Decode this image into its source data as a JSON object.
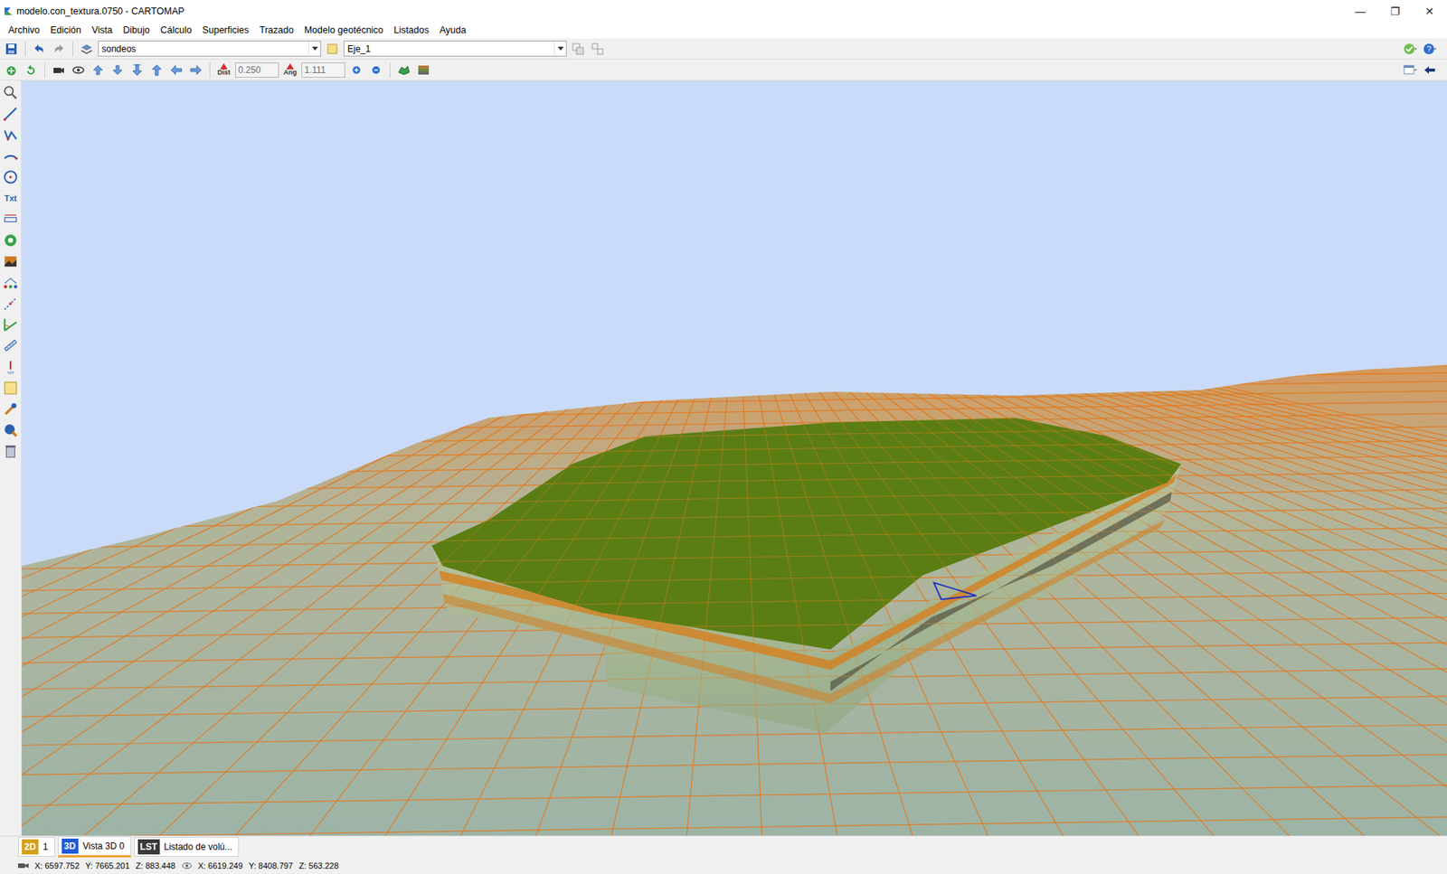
{
  "window": {
    "title": "modelo.con_textura.0750 - CARTOMAP",
    "controls": [
      "—",
      "❐",
      "✕"
    ]
  },
  "menu": [
    "Archivo",
    "Edición",
    "Vista",
    "Dibujo",
    "Cálculo",
    "Superficies",
    "Trazado",
    "Modelo geotécnico",
    "Listados",
    "Ayuda"
  ],
  "toolbar": {
    "layer": "sondeos",
    "axis": "Eje_1",
    "dist": {
      "label": "Dist",
      "value": "0.250"
    },
    "ang": {
      "label": "Ang",
      "value": "1.111"
    }
  },
  "view_tabs": [
    {
      "tag": "2D",
      "label": "1",
      "selected": false,
      "color": "#d4a017"
    },
    {
      "tag": "3D",
      "label": "Vista 3D 0",
      "selected": true,
      "color": "#1f5bd6"
    },
    {
      "tag": "LST",
      "label": "Listado de volú...",
      "selected": false,
      "color": "#3a3a3a"
    }
  ],
  "status_bar": {
    "camera": {
      "x": "X: 6597.752",
      "y": "Y: 7665.201",
      "z": "Z: 883.448"
    },
    "target": {
      "x": "X: 6619.249",
      "y": "Y: 8408.797",
      "z": "Z: 563.228"
    }
  }
}
